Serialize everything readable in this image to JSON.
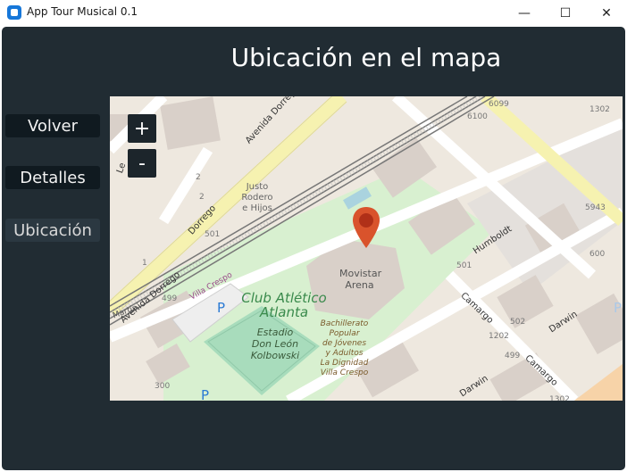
{
  "window": {
    "title": "App Tour Musical 0.1",
    "minimize_glyph": "—",
    "maximize_glyph": "☐",
    "close_glyph": "✕"
  },
  "page": {
    "heading": "Ubicación en el mapa"
  },
  "nav": {
    "back_label": "Volver",
    "details_label": "Detalles",
    "location_label": "Ubicación"
  },
  "map": {
    "zoom_in_label": "+",
    "zoom_out_label": "-",
    "venue_label_line1": "Movistar",
    "venue_label_line2": "Arena",
    "club_line1": "Club Atlético",
    "club_line2": "Atlanta",
    "stadium_line1": "Estadio",
    "stadium_line2": "Don León",
    "stadium_line3": "Kolbowski",
    "school_line1": "Bachillerato",
    "school_line2": "Popular",
    "school_line3": "de Jóvenes",
    "school_line4": "y Adultos",
    "school_line5": "La Dignidad",
    "school_line6": "Villa Crespo",
    "shop_line1": "Justo",
    "shop_line2": "Rodero",
    "shop_line3": "e Hijos",
    "street_dorrego_1": "Avenida Dorrego",
    "street_dorrego_2": "Dorrego",
    "street_dorrego_3": "Avenida Dorrego",
    "street_humboldt": "Humboldt",
    "street_camargo_1": "Camargo",
    "street_camargo_2": "Camargo",
    "street_darwin_1": "Darwin",
    "street_darwin_2": "Darwin",
    "street_villa_crespo": "Villa Crespo",
    "street_martin": "Martín",
    "street_left": "Le",
    "num_6099": "6099",
    "num_6100": "6100",
    "num_1302a": "1302",
    "num_5943": "5943",
    "num_600": "600",
    "num_501a": "501",
    "num_501b": "501",
    "num_499a": "499",
    "num_499b": "499",
    "num_502": "502",
    "num_1202": "1202",
    "num_1302b": "1302",
    "num_300": "300",
    "num_2a": "2",
    "num_2b": "2",
    "num_1": "1",
    "parking_1": "P",
    "parking_2": "P",
    "parking_3": "P"
  }
}
